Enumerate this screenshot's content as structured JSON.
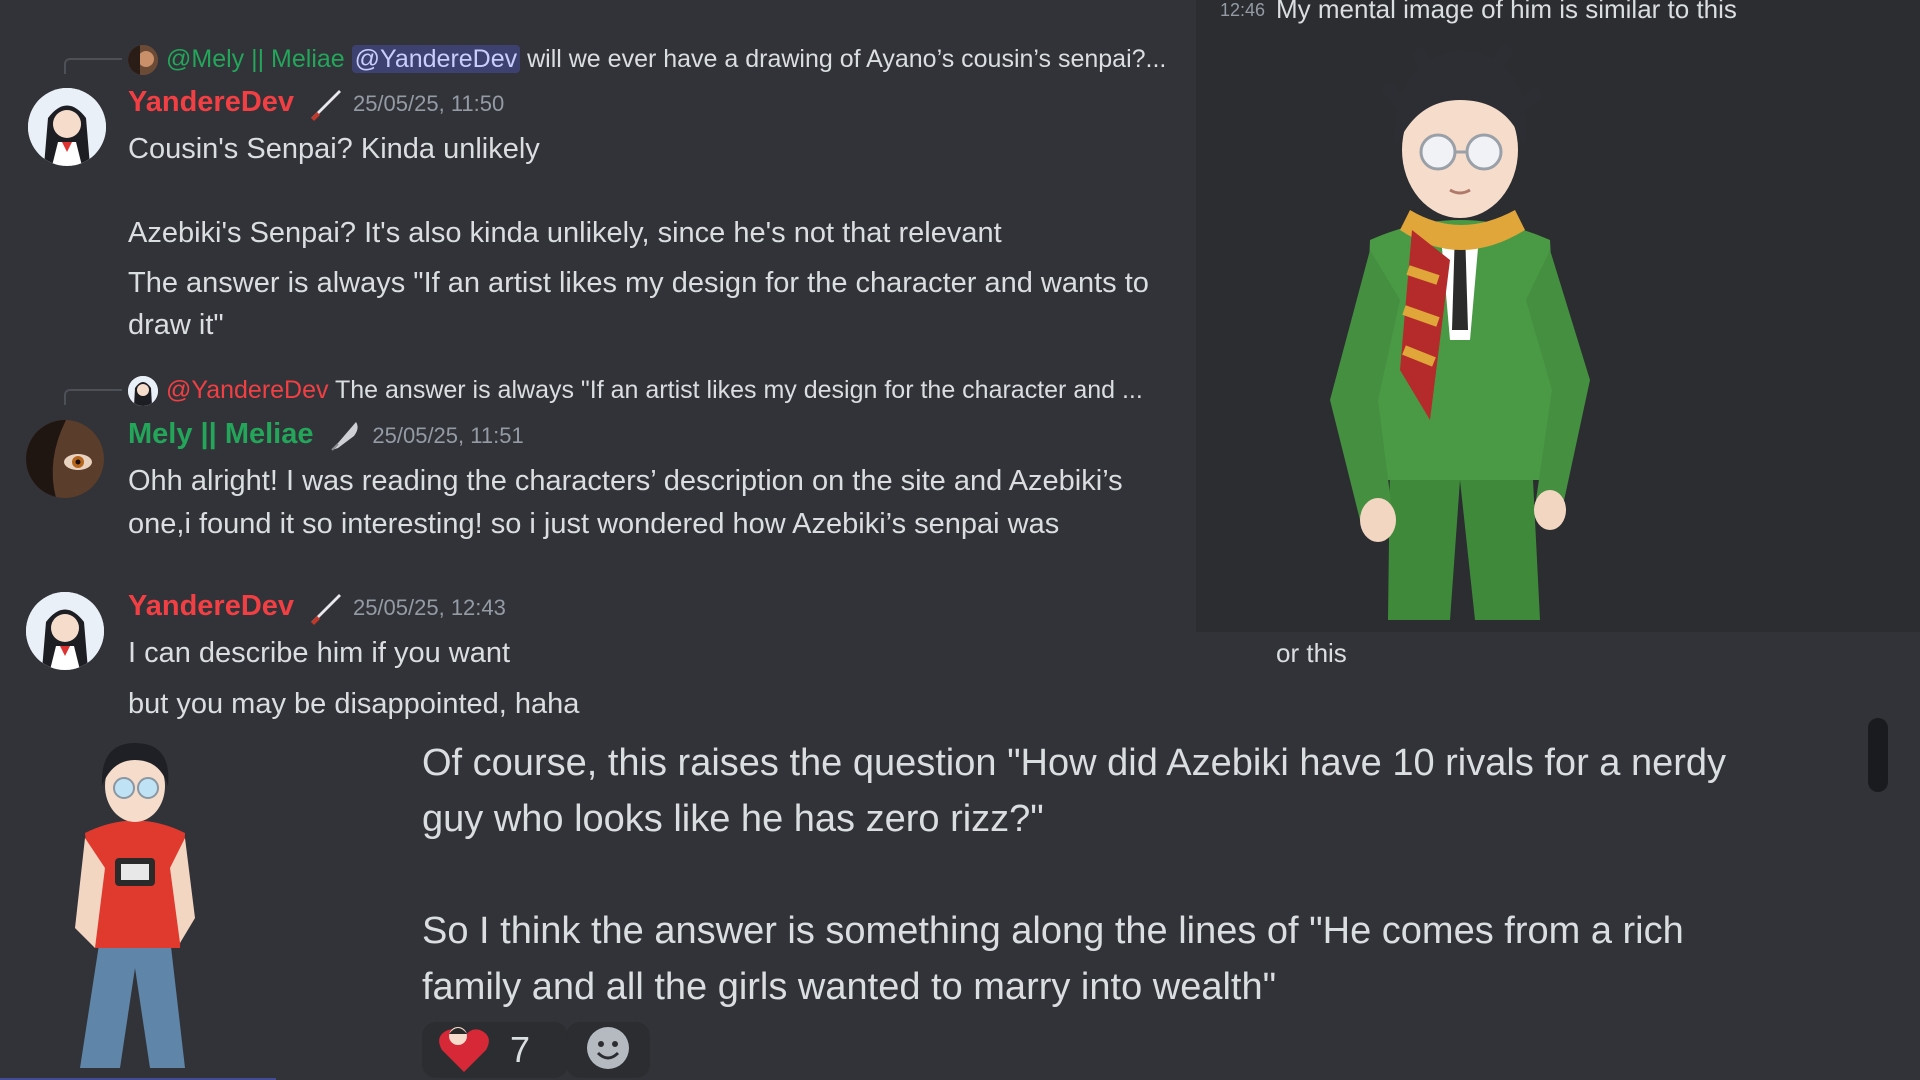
{
  "messages": [
    {
      "reply": {
        "author": "@Mely || Meliae",
        "mention": "@YandereDev",
        "text": "will we ever have a drawing of Ayano’s cousin’s senpai?..."
      },
      "author": "YandereDev",
      "timestamp": "25/05/25, 11:50",
      "lines": [
        "Cousin's Senpai? Kinda unlikely",
        "Azebiki's Senpai? It's also kinda unlikely, since he's not that relevant",
        "The answer is always \"If an artist likes my design for the character and wants to",
        "draw it\""
      ]
    },
    {
      "reply": {
        "author": "@YandereDev",
        "text": "The answer is always \"If an artist likes my design for the character and ..."
      },
      "author": "Mely || Meliae",
      "timestamp": "25/05/25, 11:51",
      "lines": [
        "Ohh alright! I was reading the characters’ description on the site and Azebiki’s",
        "one,i found it so interesting! so i just wondered how Azebiki’s senpai was"
      ]
    },
    {
      "author": "YandereDev",
      "timestamp": "25/05/25, 12:43",
      "lines": [
        "I can describe him if you want",
        "but you may be disappointed, haha"
      ]
    }
  ],
  "right_panel": {
    "timestamp": "12:46",
    "text": "My mental image of him is similar to this",
    "caption": "or this"
  },
  "bottom": {
    "para1": [
      "Of course, this raises the question \"How did Azebiki have 10 rivals for a nerdy",
      "guy who looks like he has zero rizz?\""
    ],
    "para2": [
      "So I think the answer is something along the lines of \"He comes from a rich",
      "family and all the girls wanted to marry into wealth\""
    ],
    "reactions": [
      {
        "icon": "heart-character-emoji-icon",
        "count": "7"
      },
      {
        "icon": "add-reaction-icon",
        "count": ""
      }
    ]
  },
  "colors": {
    "yanderedev": "#f23f43",
    "mely": "#23a55a",
    "background": "#313338",
    "panel": "#2b2d31"
  }
}
